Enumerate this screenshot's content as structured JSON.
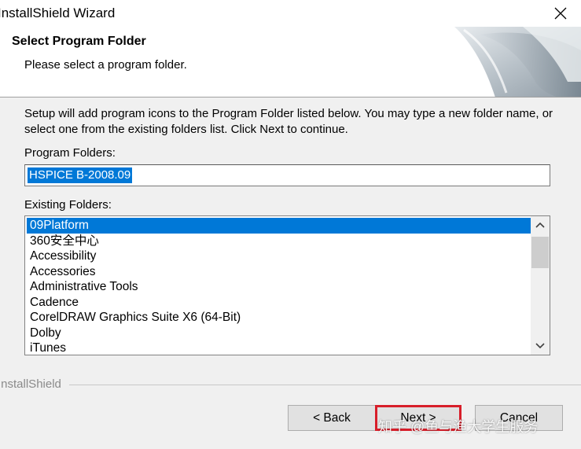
{
  "window": {
    "title": "InstallShield Wizard"
  },
  "header": {
    "title": "Select Program Folder",
    "subtitle": "Please select a program folder."
  },
  "body": {
    "description": "Setup will add program icons to the Program Folder listed below.  You may type a new folder name, or select one from the existing folders list.  Click Next to continue.",
    "program_folders_label": "Program Folders:",
    "program_folder_value": "HSPICE B-2008.09",
    "existing_folders_label": "Existing Folders:",
    "existing_folders": [
      "09Platform",
      "360安全中心",
      "Accessibility",
      "Accessories",
      "Administrative Tools",
      "Cadence",
      "CorelDRAW Graphics Suite X6 (64-Bit)",
      "Dolby",
      "iTunes"
    ],
    "selected_folder_index": 0
  },
  "footer": {
    "brand": "InstallShield",
    "back_label": "< Back",
    "next_label": "Next >",
    "cancel_label": "Cancel"
  },
  "watermark": "知乎 @鱼与渔大学生服务",
  "colors": {
    "selection": "#0078d7",
    "highlight_border": "#d81e2a",
    "dialog_bg": "#f0f0f0"
  },
  "icons": {
    "close": "close-icon",
    "scroll_up": "chevron-up-icon",
    "scroll_down": "chevron-down-icon"
  }
}
